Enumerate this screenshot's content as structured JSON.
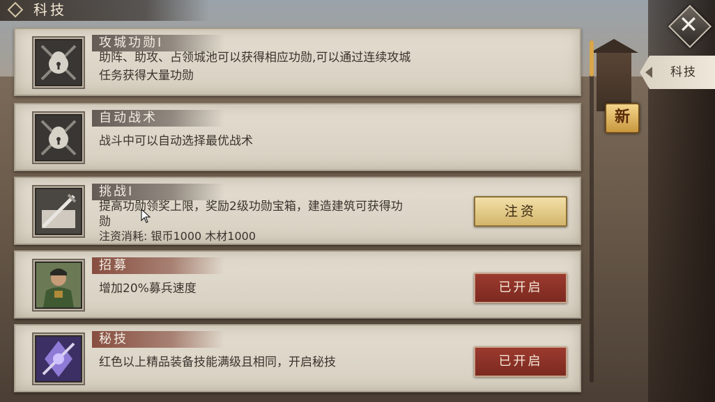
{
  "header": {
    "title": "科技"
  },
  "close": {
    "label": "✕"
  },
  "side_tab": {
    "label": "科技"
  },
  "new_badge": {
    "label": "新"
  },
  "items": [
    {
      "name": "攻城功勋Ⅰ",
      "desc_lines": [
        "助阵、助攻、占领城池可以获得相应功勋,可以通过连续攻城",
        "任务获得大量功勋"
      ],
      "icon": "lock-icon"
    },
    {
      "name": "自动战术",
      "desc_lines": [
        "战斗中可以自动选择最优战术"
      ],
      "icon": "lock-icon"
    },
    {
      "name": "挑战Ⅰ",
      "desc_lines": [
        "提高功勋领奖上限，奖励2级功勋宝箱，建造建筑可获得功",
        "勋"
      ],
      "cost": "注资消耗: 银币1000   木材1000",
      "button": "注资",
      "icon": "sword-scroll-icon"
    },
    {
      "name": "招募",
      "desc_lines": [
        "增加20%募兵速度"
      ],
      "button": "已开启",
      "icon": "general-portrait-icon"
    },
    {
      "name": "秘技",
      "desc_lines": [
        "红色以上精品装备技能满级且相同，开启秘技"
      ],
      "button": "已开启",
      "icon": "weapon-crystal-icon"
    }
  ],
  "colors": {
    "gold_button": "#d3b56b",
    "red_button": "#7b2920",
    "panel": "#dcd5c7"
  }
}
